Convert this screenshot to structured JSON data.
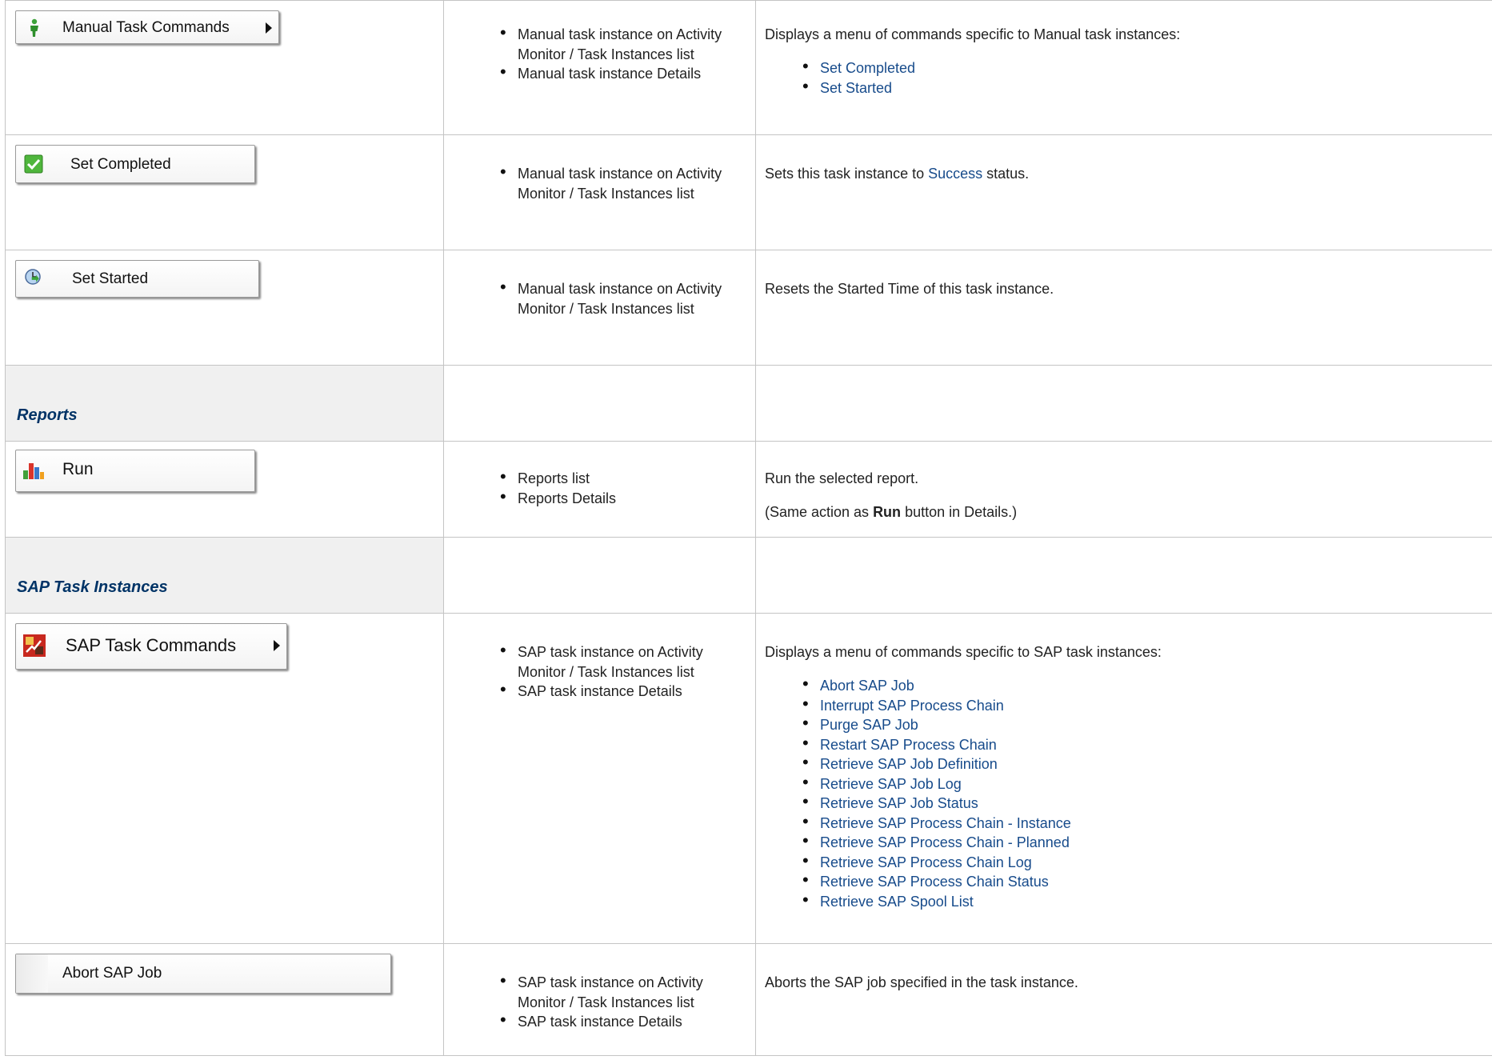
{
  "rows": {
    "manual_cmds": {
      "button": "Manual Task Commands",
      "where": [
        "Manual task instance on Activity Monitor / Task Instances list",
        "Manual task instance Details"
      ],
      "desc": "Displays a menu of commands specific to Manual task instances:",
      "links": [
        "Set Completed",
        "Set Started"
      ]
    },
    "set_completed": {
      "button": "Set Completed",
      "where": [
        "Manual task instance on Activity Monitor / Task Instances list"
      ],
      "desc_before": "Sets this task instance to ",
      "desc_link": "Success",
      "desc_after": " status."
    },
    "set_started": {
      "button": "Set Started",
      "where": [
        "Manual task instance on Activity Monitor / Task Instances list"
      ],
      "desc": "Resets the Started Time of this task instance."
    },
    "reports_section": {
      "title": "Reports"
    },
    "run": {
      "button": "Run",
      "where": [
        "Reports list",
        "Reports Details"
      ],
      "desc": "Run the selected report.",
      "note_before": "(Same action as ",
      "note_bold": "Run",
      "note_after": " button in Details.)"
    },
    "sap_section": {
      "title": "SAP Task Instances"
    },
    "sap_cmds": {
      "button": "SAP Task Commands",
      "where": [
        "SAP task instance on Activity Monitor / Task Instances list",
        "SAP task instance Details"
      ],
      "desc": "Displays a menu of commands specific to SAP task instances:",
      "links": [
        "Abort SAP Job",
        "Interrupt SAP Process Chain",
        "Purge SAP Job",
        "Restart SAP Process Chain",
        "Retrieve SAP Job Definition",
        "Retrieve SAP Job Log",
        "Retrieve SAP Job Status",
        "Retrieve SAP Process Chain - Instance",
        "Retrieve SAP Process Chain - Planned",
        "Retrieve SAP Process Chain Log",
        "Retrieve SAP Process Chain Status",
        "Retrieve SAP Spool List"
      ]
    },
    "abort_sap": {
      "button": "Abort SAP Job",
      "where": [
        "SAP task instance on Activity Monitor / Task Instances list",
        "SAP task instance Details"
      ],
      "desc": "Aborts the SAP job specified in the task instance."
    }
  },
  "colors": {
    "link": "#174b8b",
    "section_title": "#003366",
    "section_bg": "#f0f0f0",
    "border": "#c4c4c4"
  },
  "icons": {
    "manual_cmds": "manual-task-person-icon",
    "set_completed": "green-check-icon",
    "set_started": "clock-arrow-icon",
    "run": "bar-chart-icon",
    "sap_cmds": "sap-task-icon"
  }
}
